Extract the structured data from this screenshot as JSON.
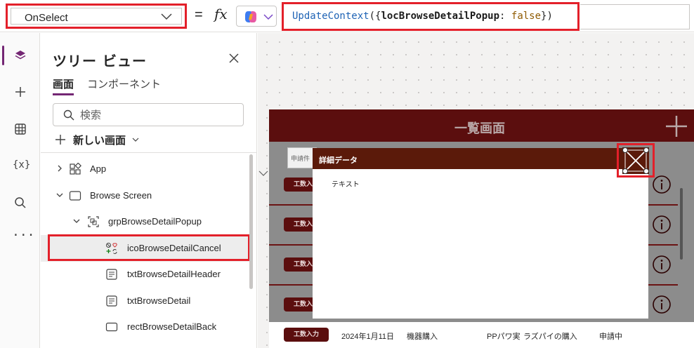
{
  "formula_bar": {
    "property": "OnSelect",
    "equals": "=",
    "fx": "fx",
    "formula": {
      "fn": "UpdateContext",
      "open": "({",
      "variable": "locBrowseDetailPopup",
      "colon": ":",
      "value": "false",
      "close": "})"
    }
  },
  "rail": {
    "icons": [
      "layers-icon",
      "plus-icon",
      "table-icon",
      "variables-icon",
      "search-icon",
      "more-icon"
    ],
    "variables_text": "{x}",
    "more_text": "···"
  },
  "tree": {
    "title": "ツリー ビュー",
    "tabs": {
      "screens": "画面",
      "components": "コンポーネント"
    },
    "search_placeholder": "検索",
    "new_screen": "新しい画面",
    "items": [
      {
        "label": "App"
      },
      {
        "label": "Browse Screen"
      },
      {
        "label": "grpBrowseDetailPopup"
      },
      {
        "label": "icoBrowseDetailCancel"
      },
      {
        "label": "txtBrowseDetailHeader"
      },
      {
        "label": "txtBrowseDetail"
      },
      {
        "label": "rectBrowseDetailBack"
      }
    ]
  },
  "app": {
    "title": "一覧画面",
    "search_placeholder": "申請件",
    "badge": "工数入力",
    "last_row": {
      "badge": "工数入力",
      "date": "2024年1月11日",
      "category": "機器購入",
      "person": "PPパワ実",
      "title": "ラズパイの購入",
      "status": "申請中"
    },
    "popup": {
      "title": "詳細データ",
      "body": "テキスト"
    }
  },
  "colors": {
    "accent": "#742774",
    "highlight": "#e3202a",
    "app_header": "#5b0e0e",
    "popup_header": "#5b1a0a"
  }
}
